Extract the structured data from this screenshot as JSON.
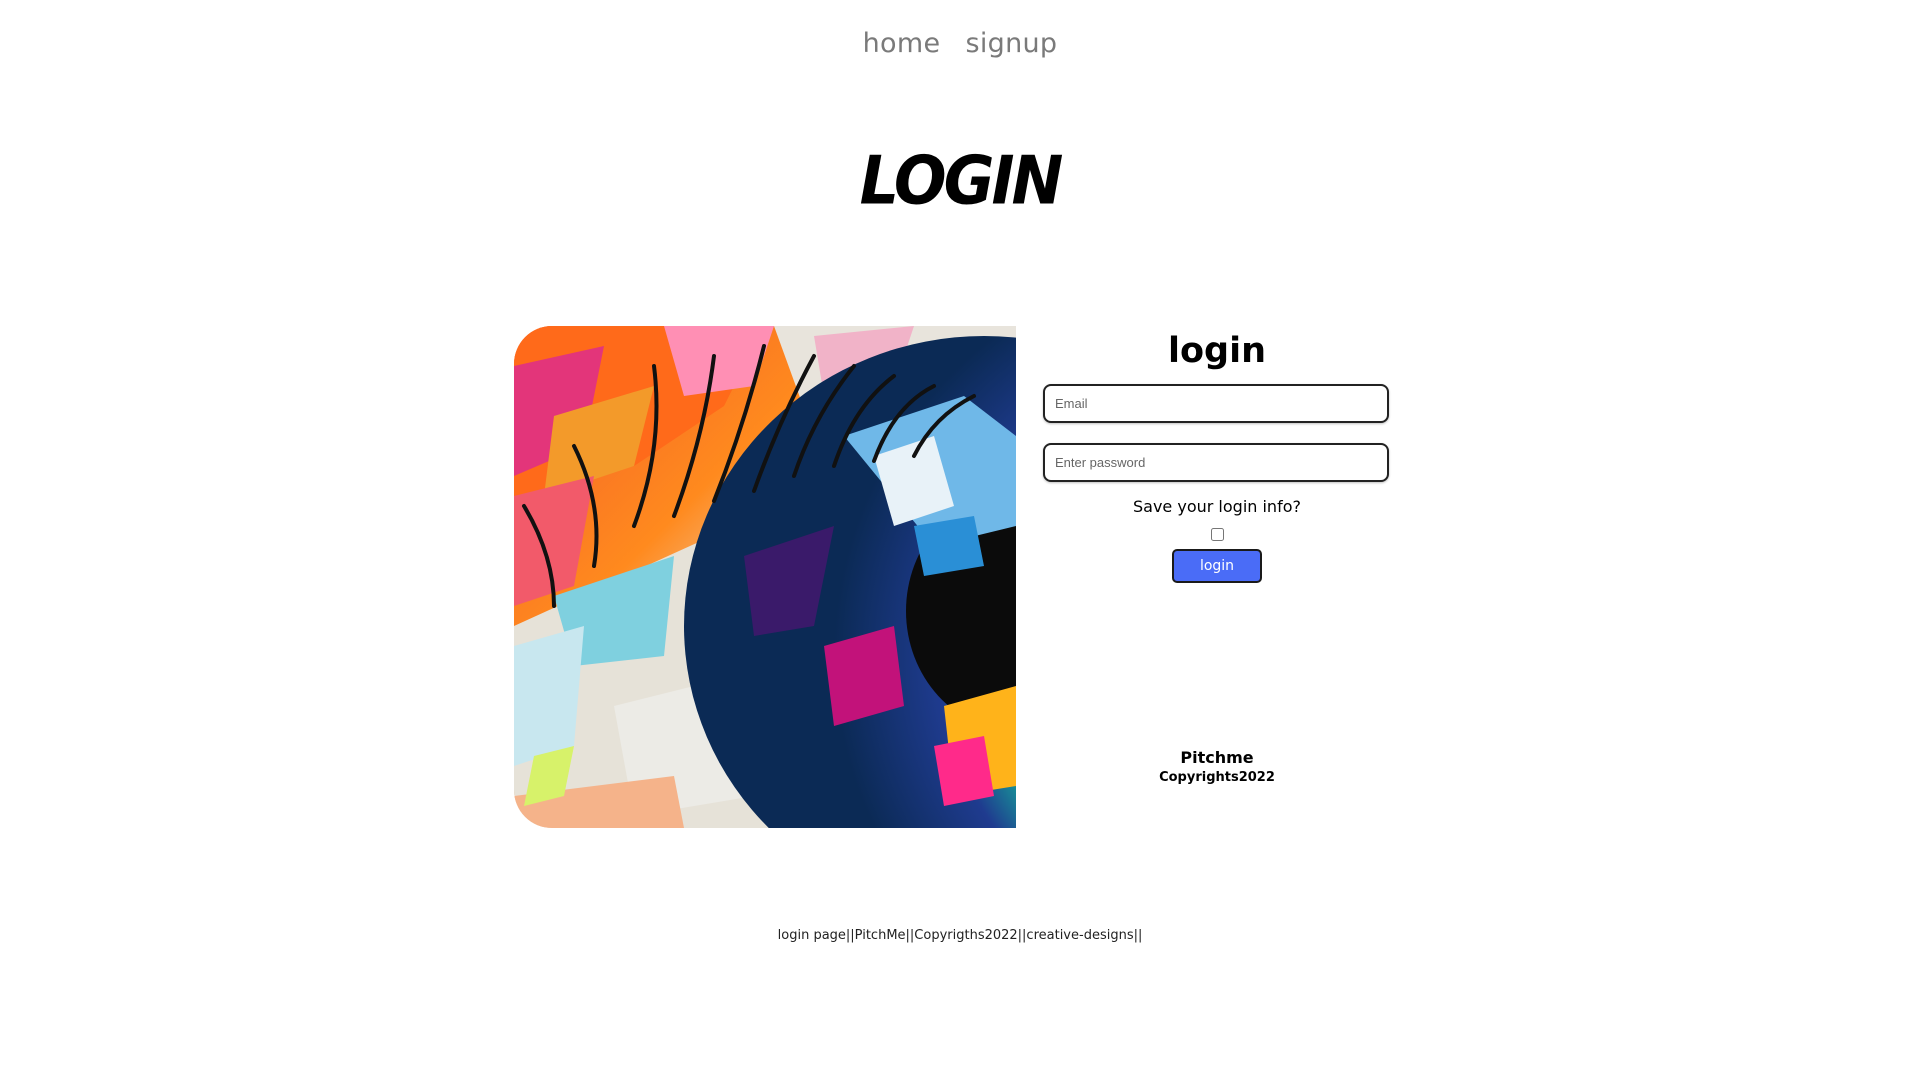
{
  "nav": {
    "items": [
      {
        "label": "home"
      },
      {
        "label": "signup"
      }
    ]
  },
  "hero": {
    "title": "LOGIN"
  },
  "form": {
    "title": "login",
    "email": {
      "placeholder": "Email",
      "value": ""
    },
    "password": {
      "placeholder": "Enter password",
      "value": ""
    },
    "save_label": "Save your login info?",
    "save_checked": false,
    "submit_label": "login"
  },
  "brand": {
    "name": "Pitchme",
    "copyright": "Copyrights2022"
  },
  "footer": {
    "text": "login page||PitchMe||Copyrigths2022||creative-designs||"
  },
  "colors": {
    "button": "#4a6cf7",
    "nav_text": "#7a7a7a"
  },
  "images": {
    "painting": "colorful-eye-painting"
  }
}
